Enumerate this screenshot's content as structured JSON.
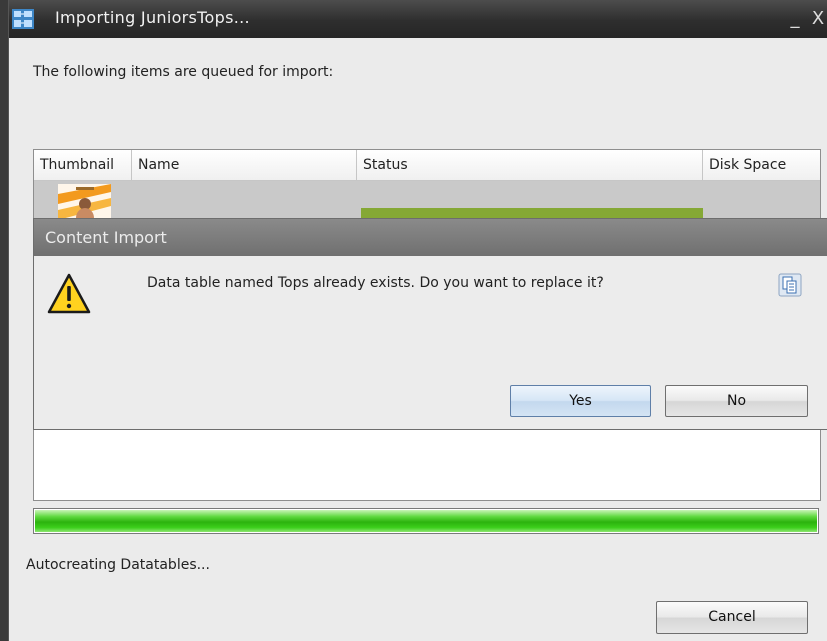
{
  "window": {
    "title": "Importing JuniorsTops...",
    "minimize_glyph": "_",
    "close_glyph": "X"
  },
  "intro_text": "The following items are queued for import:",
  "grid": {
    "columns": [
      "Thumbnail",
      "Name",
      "Status",
      "Disk Space"
    ],
    "rows": [
      {
        "thumbnail": "thumbnail-image",
        "name": "",
        "status_progress": 1.0,
        "disk_space": ""
      }
    ]
  },
  "overall_progress": 1.0,
  "status_text": "Autocreating Datatables...",
  "buttons": {
    "cancel": "Cancel"
  },
  "dialog": {
    "title": "Content Import",
    "message": "Data table named Tops already exists. Do you want to replace it?",
    "yes": "Yes",
    "no": "No",
    "icon": "warning-icon",
    "copy_icon": "copy-icon"
  },
  "colors": {
    "progress_green": "#2cb30e",
    "row_status_green": "#85a835",
    "titlebar": "#2e2e2e",
    "dialog_titlebar": "#7a7a7a"
  }
}
